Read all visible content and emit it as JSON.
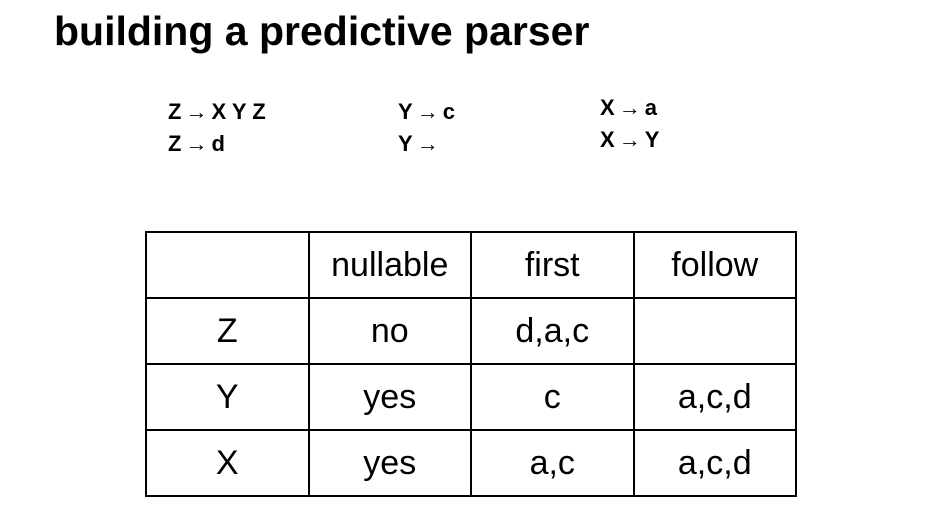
{
  "title": "building a predictive parser",
  "productions": {
    "z_group": [
      {
        "lhs": "Z",
        "arrow": "→",
        "rhs": "X Y Z"
      },
      {
        "lhs": "Z",
        "arrow": "→",
        "rhs": "d"
      }
    ],
    "y_group": [
      {
        "lhs": "Y",
        "arrow": "→",
        "rhs": "c"
      },
      {
        "lhs": "Y",
        "arrow": "→",
        "rhs": ""
      }
    ],
    "x_group": [
      {
        "lhs": "X",
        "arrow": "→",
        "rhs": "a"
      },
      {
        "lhs": "X",
        "arrow": "→",
        "rhs": "Y"
      }
    ]
  },
  "table": {
    "headers": [
      "",
      "nullable",
      "first",
      "follow"
    ],
    "rows": [
      {
        "symbol": "Z",
        "nullable": "no",
        "first": "d,a,c",
        "follow": ""
      },
      {
        "symbol": "Y",
        "nullable": "yes",
        "first": "c",
        "follow": "a,c,d"
      },
      {
        "symbol": "X",
        "nullable": "yes",
        "first": "a,c",
        "follow": "a,c,d"
      }
    ]
  }
}
